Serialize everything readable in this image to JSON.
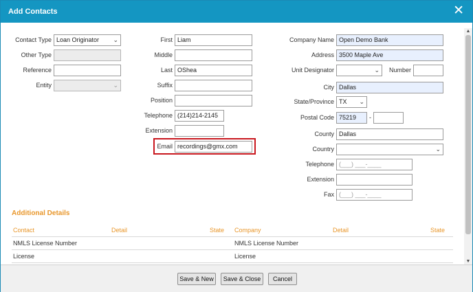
{
  "dialog": {
    "title": "Add Contacts"
  },
  "left": {
    "contact_type": {
      "label": "Contact Type",
      "value": "Loan Originator"
    },
    "other_type": {
      "label": "Other Type",
      "value": ""
    },
    "reference": {
      "label": "Reference",
      "value": ""
    },
    "entity": {
      "label": "Entity",
      "value": ""
    }
  },
  "middle": {
    "first": {
      "label": "First",
      "value": "Liam"
    },
    "middle": {
      "label": "Middle",
      "value": ""
    },
    "last": {
      "label": "Last",
      "value": "OShea"
    },
    "suffix": {
      "label": "Suffix",
      "value": ""
    },
    "position": {
      "label": "Position",
      "value": ""
    },
    "telephone": {
      "label": "Telephone",
      "value": "(214)214-2145"
    },
    "extension": {
      "label": "Extension",
      "value": ""
    },
    "email": {
      "label": "Email",
      "value": "recordings@gmx.com"
    }
  },
  "right": {
    "company_name": {
      "label": "Company Name",
      "value": "Open Demo Bank"
    },
    "address": {
      "label": "Address",
      "value": "3500 Maple Ave"
    },
    "unit_designator": {
      "label": "Unit Designator",
      "value": ""
    },
    "number": {
      "label": "Number",
      "value": ""
    },
    "city": {
      "label": "City",
      "value": "Dallas"
    },
    "state": {
      "label": "State/Province",
      "value": "TX"
    },
    "postal_code": {
      "label": "Postal Code",
      "value": "75219",
      "ext": "",
      "sep": "-"
    },
    "county": {
      "label": "County",
      "value": "Dallas"
    },
    "country": {
      "label": "Country",
      "value": ""
    },
    "telephone": {
      "label": "Telephone",
      "placeholder": "(___) ___-____"
    },
    "extension": {
      "label": "Extension",
      "value": ""
    },
    "fax": {
      "label": "Fax",
      "placeholder": "(___) ___-____"
    }
  },
  "additional": {
    "title": "Additional Details",
    "headers": {
      "contact": "Contact",
      "detail1": "Detail",
      "state1": "State",
      "company": "Company",
      "detail2": "Detail",
      "state2": "State"
    },
    "rows": [
      {
        "contact": "NMLS License Number",
        "company": "NMLS License Number"
      },
      {
        "contact": "License",
        "company": "License"
      }
    ]
  },
  "footer": {
    "save_new": "Save & New",
    "save_close": "Save & Close",
    "cancel": "Cancel"
  },
  "icons": {
    "close": "close-icon",
    "chevron": "chevron-down-icon"
  }
}
